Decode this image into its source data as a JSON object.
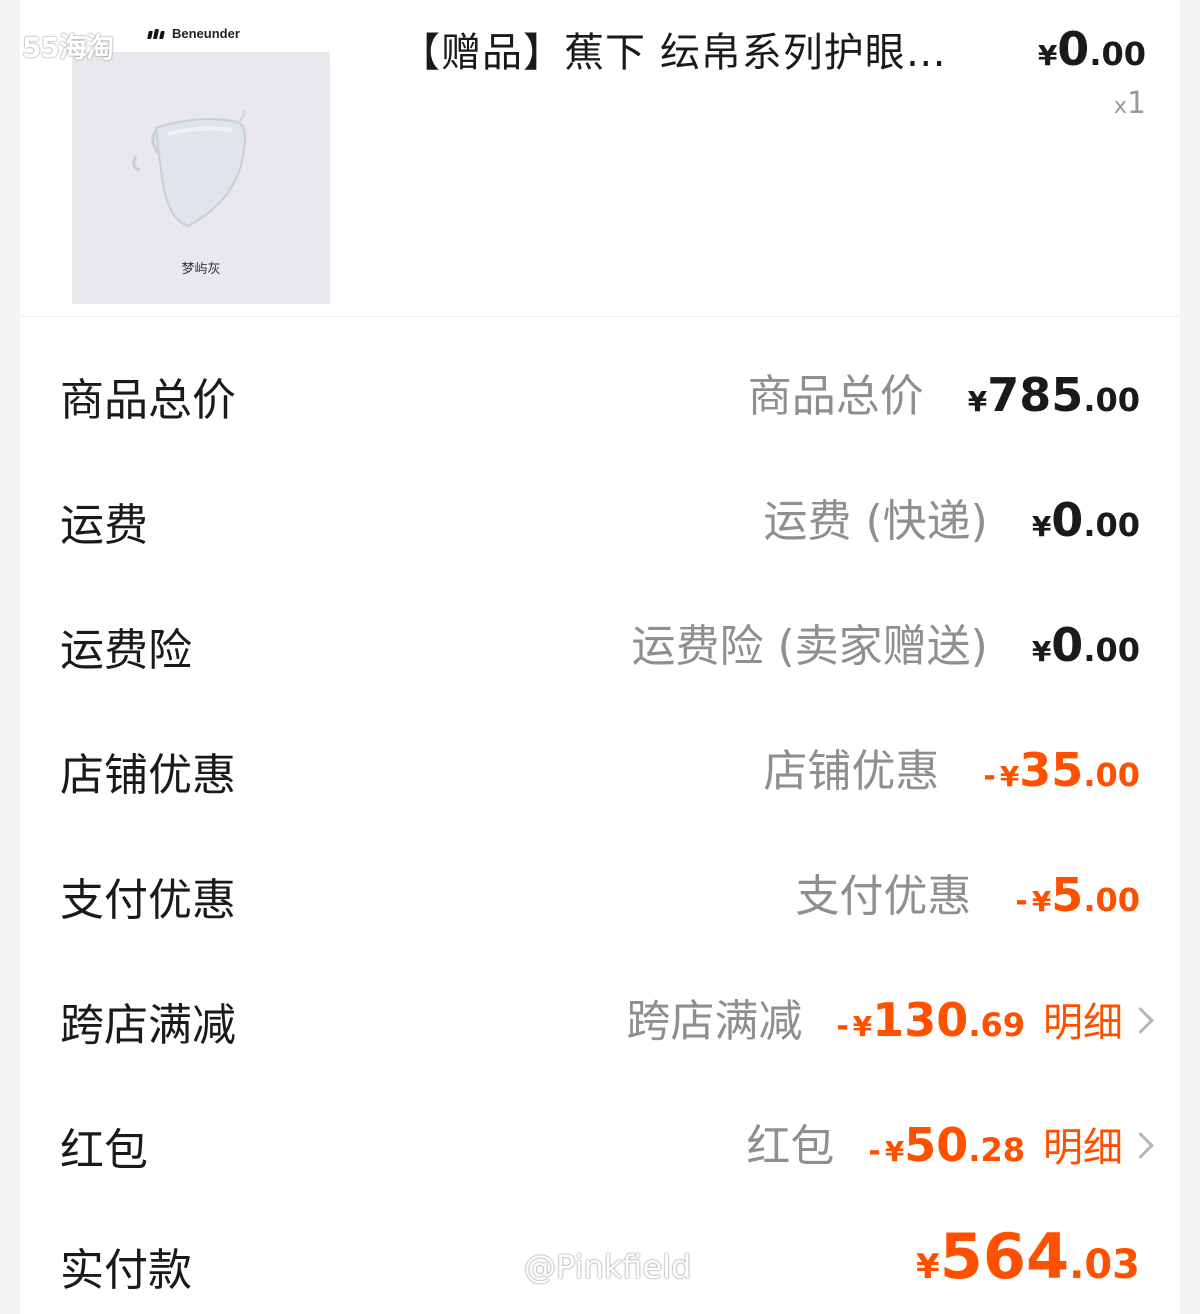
{
  "watermarks": {
    "site": "55海淘",
    "user": "@Pinkfield"
  },
  "product": {
    "brand": "Beneunder",
    "image_caption": "梦屿灰",
    "title": "【赠品】蕉下 纭帛系列护眼…",
    "price": {
      "currency": "¥",
      "integer": "0",
      "decimal": ".00"
    },
    "qty_prefix": "x",
    "qty": "1"
  },
  "summary": [
    {
      "label": "商品总价",
      "sub": "商品总价",
      "currency": "¥",
      "integer": "785",
      "decimal": ".00",
      "minus": "",
      "style": "normal",
      "detail": ""
    },
    {
      "label": "运费",
      "sub": "运费 (快递)",
      "currency": "¥",
      "integer": "0",
      "decimal": ".00",
      "minus": "",
      "style": "normal",
      "detail": ""
    },
    {
      "label": "运费险",
      "sub": "运费险 (卖家赠送)",
      "currency": "¥",
      "integer": "0",
      "decimal": ".00",
      "minus": "",
      "style": "normal",
      "detail": ""
    },
    {
      "label": "店铺优惠",
      "sub": "店铺优惠",
      "currency": "¥",
      "integer": "35",
      "decimal": ".00",
      "minus": "-",
      "style": "orange",
      "detail": ""
    },
    {
      "label": "支付优惠",
      "sub": "支付优惠",
      "currency": "¥",
      "integer": "5",
      "decimal": ".00",
      "minus": "-",
      "style": "orange",
      "detail": ""
    },
    {
      "label": "跨店满减",
      "sub": "跨店满减",
      "currency": "¥",
      "integer": "130",
      "decimal": ".69",
      "minus": "-",
      "style": "orange",
      "detail": "明细"
    },
    {
      "label": "红包",
      "sub": "红包",
      "currency": "¥",
      "integer": "50",
      "decimal": ".28",
      "minus": "-",
      "style": "orange",
      "detail": "明细"
    }
  ],
  "total": {
    "label": "实付款",
    "currency": "¥",
    "integer": "564",
    "decimal": ".03"
  },
  "colors": {
    "accent": "#ff5000",
    "text": "#1a1a1a",
    "muted": "#8f8f8f"
  }
}
